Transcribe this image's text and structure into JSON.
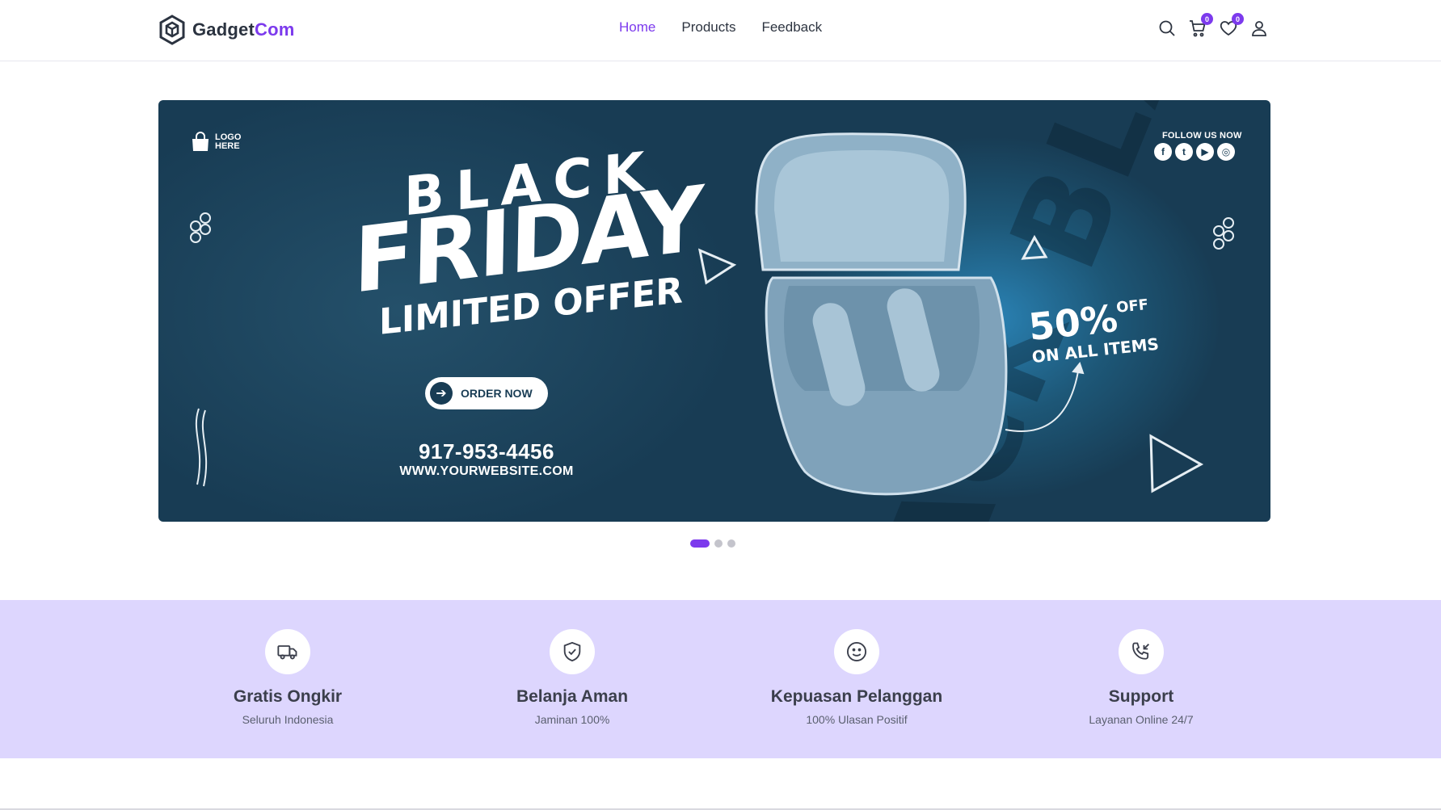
{
  "brand": {
    "name_part1": "Gadget",
    "name_part2": "Com",
    "accent": "#7c3aed"
  },
  "nav": {
    "links": [
      {
        "label": "Home",
        "active": true
      },
      {
        "label": "Products",
        "active": false
      },
      {
        "label": "Feedback",
        "active": false
      }
    ],
    "icons": [
      "search-icon",
      "cart-icon",
      "heart-icon",
      "user-icon"
    ],
    "cart_count": "0",
    "wishlist_count": "0"
  },
  "hero": {
    "logo_text": "LOGO HERE",
    "follow_text": "FOLLOW US NOW",
    "social": [
      "f",
      "t",
      "▶",
      "◎"
    ],
    "headline_1": "BLACK",
    "headline_2": "FRIDAY",
    "headline_3": "LIMITED OFFER",
    "cta_label": "ORDER NOW",
    "phone": "917-953-4456",
    "website": "WWW.YOURWEBSITE.COM",
    "discount": "50%",
    "discount_off": "OFF",
    "discount_sub": "ON ALL ITEMS",
    "bg_color": "#183c54",
    "slide_count": 3,
    "active_slide": 1
  },
  "features": [
    {
      "icon": "truck-icon",
      "title": "Gratis Ongkir",
      "subtitle": "Seluruh Indonesia"
    },
    {
      "icon": "shield-check-icon",
      "title": "Belanja Aman",
      "subtitle": "Jaminan 100%"
    },
    {
      "icon": "smile-icon",
      "title": "Kepuasan Pelanggan",
      "subtitle": "100% Ulasan Positif"
    },
    {
      "icon": "phone-incoming-icon",
      "title": "Support",
      "subtitle": "Layanan Online 24/7"
    }
  ],
  "features_bg": "#ddd6fe"
}
